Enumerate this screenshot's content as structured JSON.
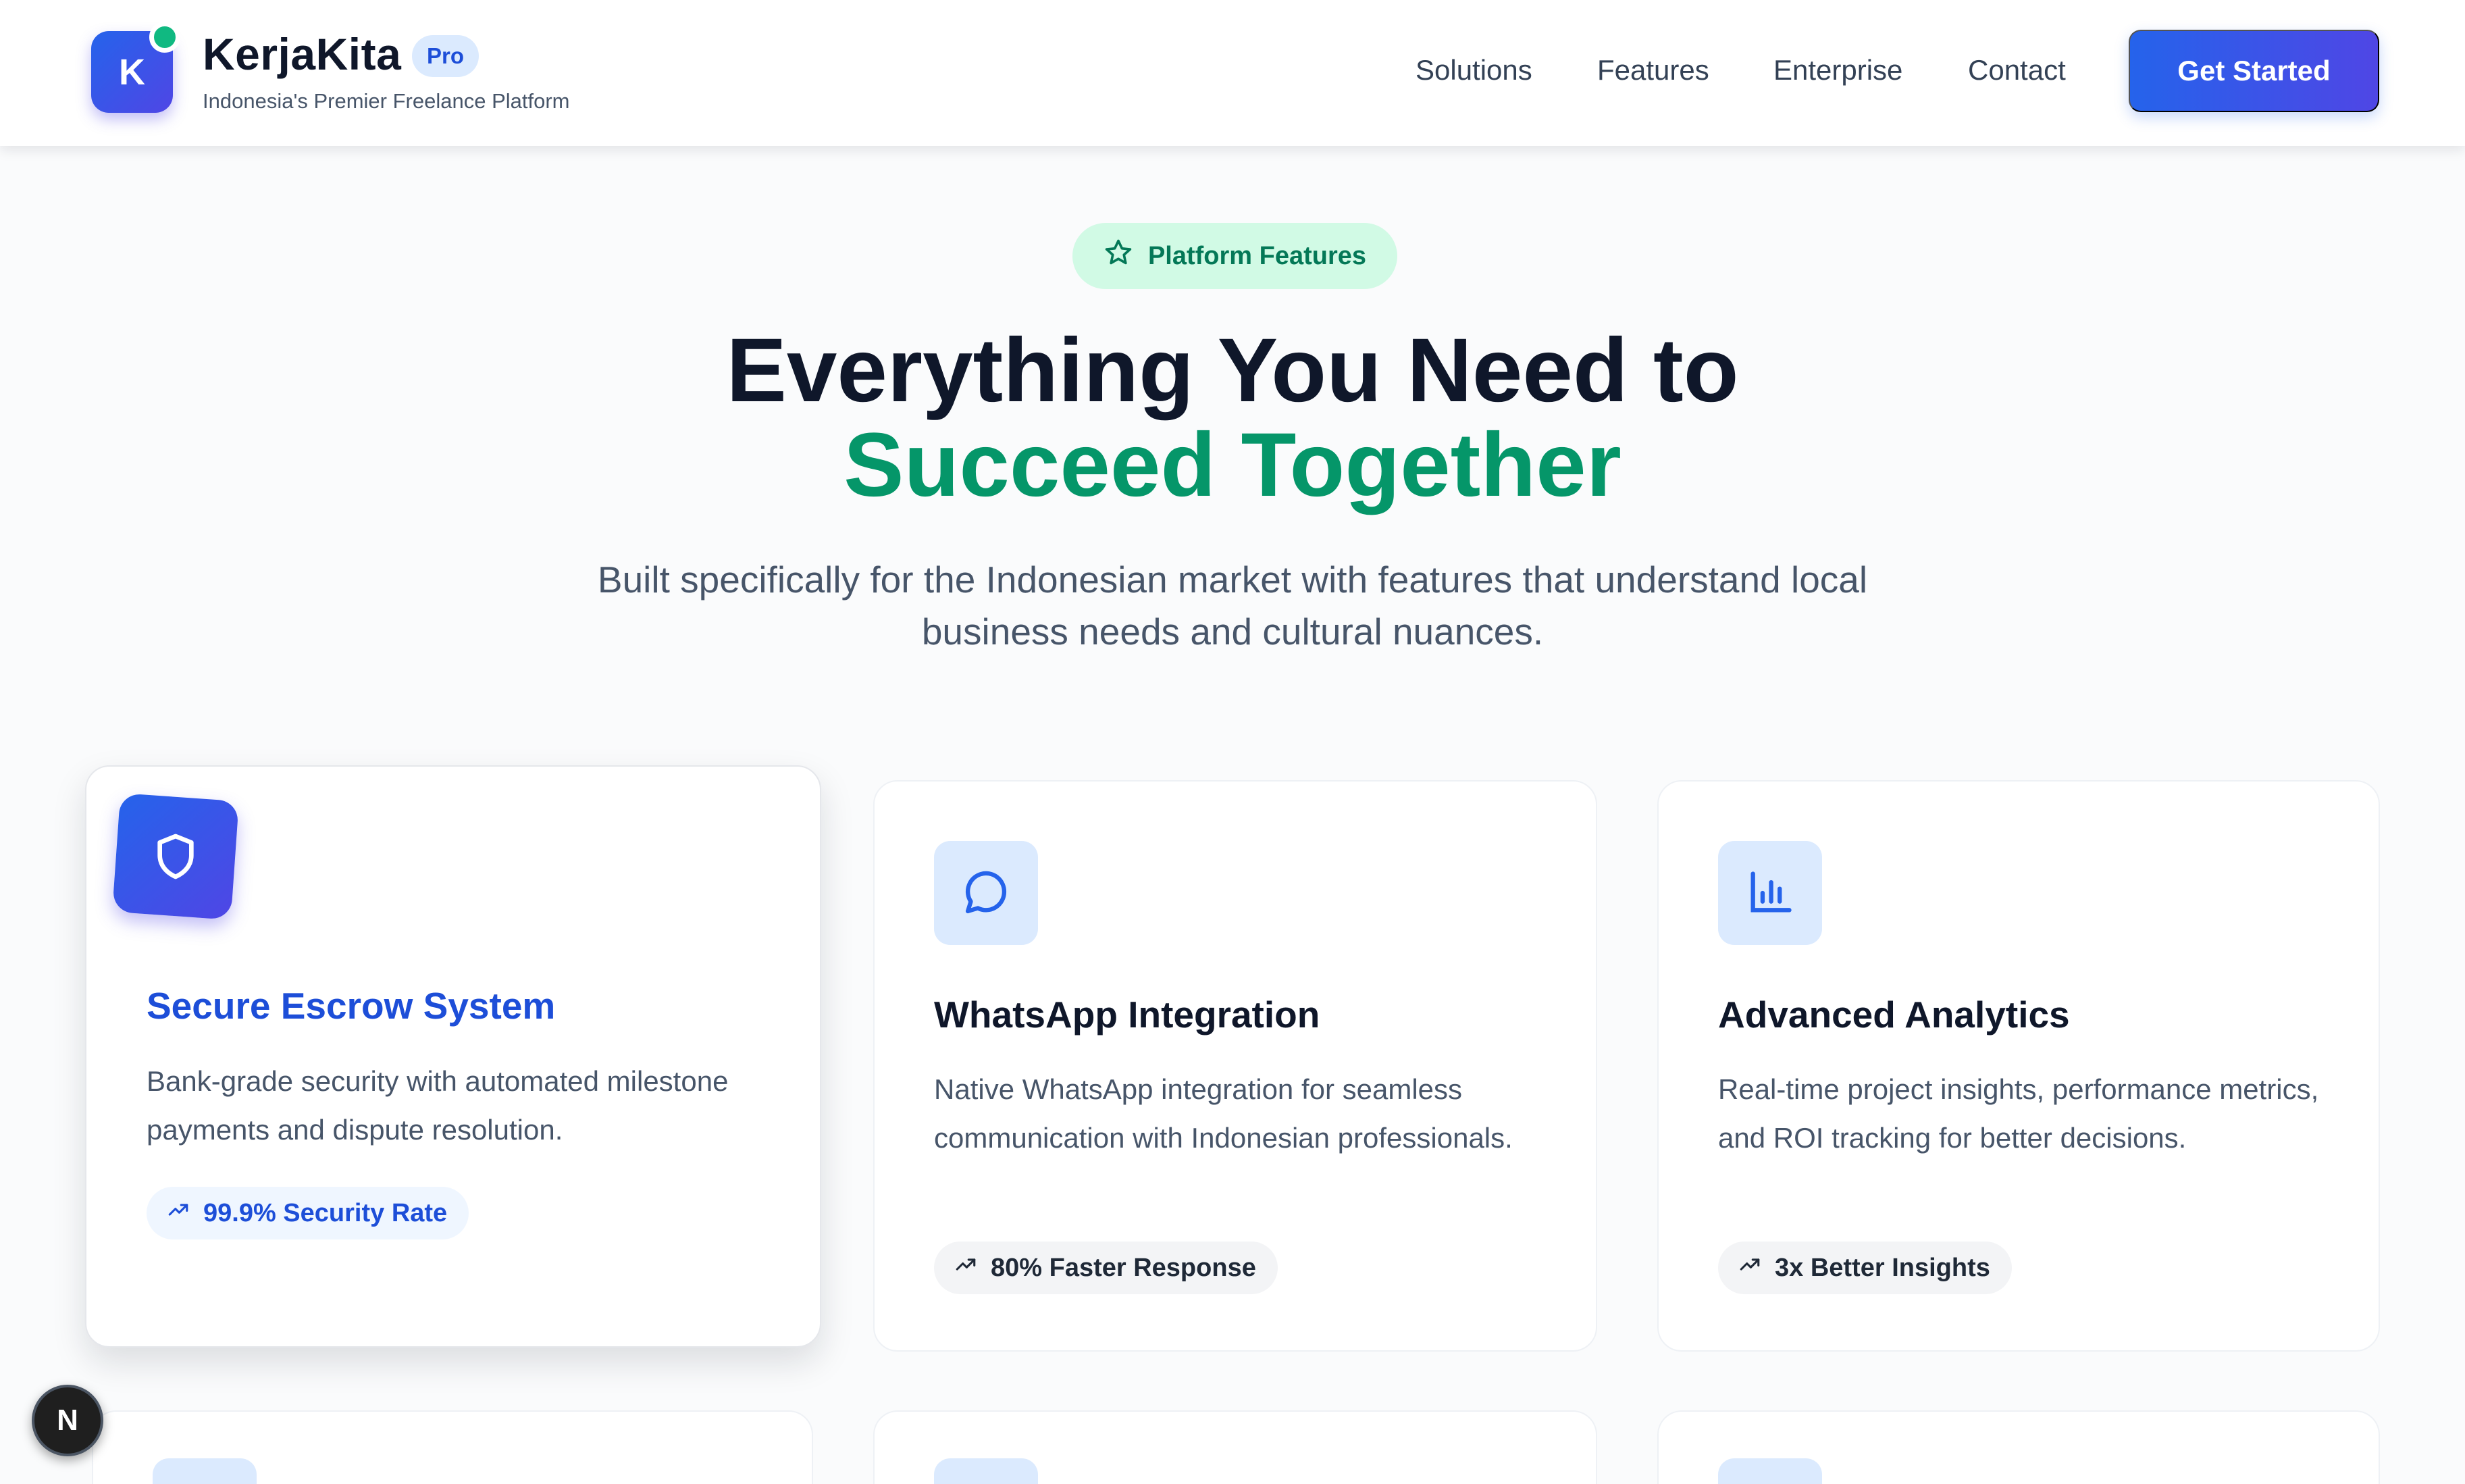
{
  "brand": {
    "logo_letter": "K",
    "name": "KerjaKita",
    "badge": "Pro",
    "tagline": "Indonesia's Premier Freelance Platform"
  },
  "nav": {
    "links": [
      "Solutions",
      "Features",
      "Enterprise",
      "Contact"
    ],
    "cta": "Get Started"
  },
  "hero": {
    "pill": "Platform Features",
    "title_line1": "Everything You Need to",
    "title_line2": "Succeed Together",
    "subtitle": "Built specifically for the Indonesian market with features that understand local business needs and cultural nuances."
  },
  "features": [
    {
      "icon": "shield-icon",
      "title": "Secure Escrow System",
      "description": "Bank-grade security with automated milestone payments and dispute resolution.",
      "stat": "99.9% Security Rate"
    },
    {
      "icon": "message-circle-icon",
      "title": "WhatsApp Integration",
      "description": "Native WhatsApp integration for seamless communication with Indonesian professionals.",
      "stat": "80% Faster Response"
    },
    {
      "icon": "bar-chart-icon",
      "title": "Advanced Analytics",
      "description": "Real-time project insights, performance metrics, and ROI tracking for better decisions.",
      "stat": "3x Better Insights"
    }
  ],
  "dev_badge": {
    "letter": "N"
  },
  "colors": {
    "primary": "#2563eb",
    "primary_dark": "#4f46e5",
    "accent_green": "#059669",
    "online_dot": "#10b981",
    "pill_bg": "#d1fae5"
  }
}
